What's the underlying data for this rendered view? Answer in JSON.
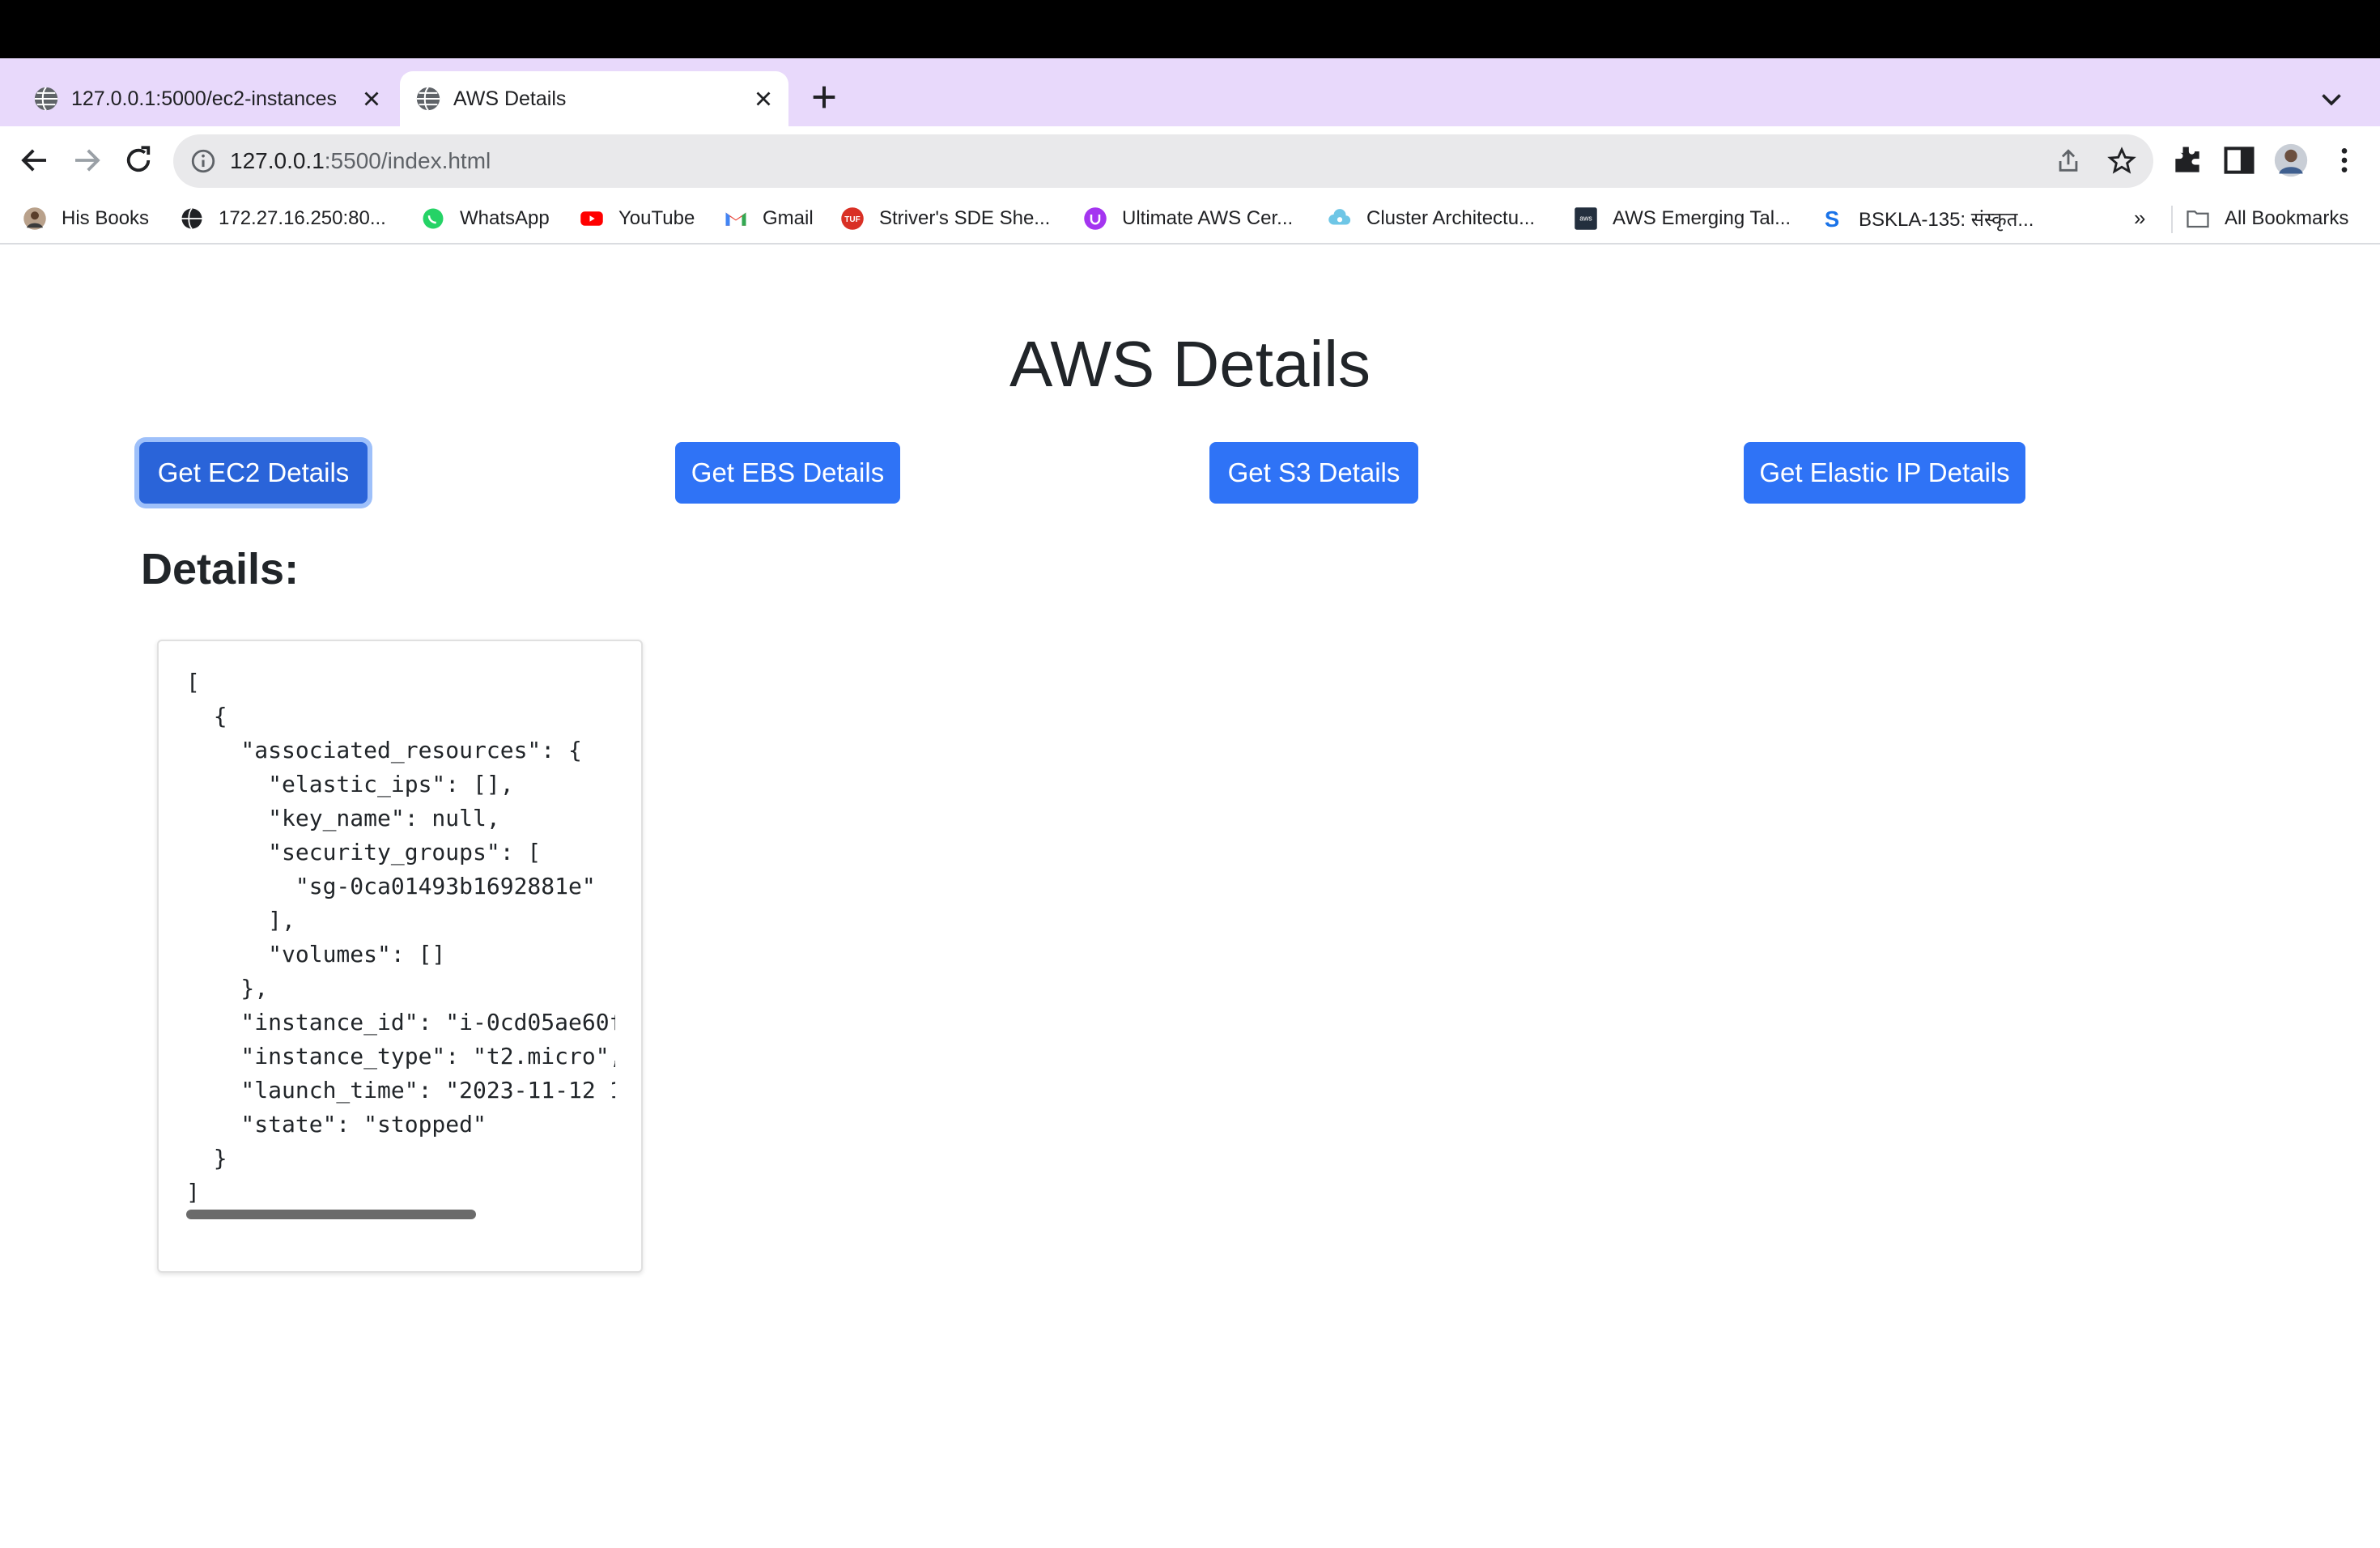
{
  "browser": {
    "tabs": [
      {
        "title": "127.0.0.1:5000/ec2-instances",
        "active": false
      },
      {
        "title": "AWS Details",
        "active": true
      }
    ],
    "url_host": "127.0.0.1",
    "url_rest": ":5500/index.html"
  },
  "bookmarks": {
    "items": [
      {
        "label": "His Books",
        "icon": "avatar-icon"
      },
      {
        "label": "172.27.16.250:80...",
        "icon": "globe-icon"
      },
      {
        "label": "WhatsApp",
        "icon": "whatsapp-icon"
      },
      {
        "label": "YouTube",
        "icon": "youtube-icon"
      },
      {
        "label": "Gmail",
        "icon": "gmail-icon"
      },
      {
        "label": "Striver's SDE She...",
        "icon": "tuf-icon"
      },
      {
        "label": "Ultimate AWS Cer...",
        "icon": "udemy-icon"
      },
      {
        "label": "Cluster Architectu...",
        "icon": "cloud-icon"
      },
      {
        "label": "AWS Emerging Tal...",
        "icon": "aws-icon"
      },
      {
        "label": "BSKLA-135: संस्कृत...",
        "icon": "s-icon"
      }
    ],
    "more": "»",
    "all_bookmarks": "All Bookmarks"
  },
  "page": {
    "title": "AWS Details",
    "buttons": {
      "ec2": "Get EC2 Details",
      "ebs": "Get EBS Details",
      "s3": "Get S3 Details",
      "eip": "Get Elastic IP Details"
    },
    "details_heading": "Details:",
    "json_text": "[\n  {\n    \"associated_resources\": {\n      \"elastic_ips\": [],\n      \"key_name\": null,\n      \"security_groups\": [\n        \"sg-0ca01493b1692881e\"\n      ],\n      \"volumes\": []\n    },\n    \"instance_id\": \"i-0cd05ae60f\n    \"instance_type\": \"t2.micro\",\n    \"launch_time\": \"2023-11-12 1\n    \"state\": \"stopped\"\n  }\n]"
  },
  "colors": {
    "primary_button": "#2f73f6",
    "tabstrip": "#e8d9fb"
  }
}
